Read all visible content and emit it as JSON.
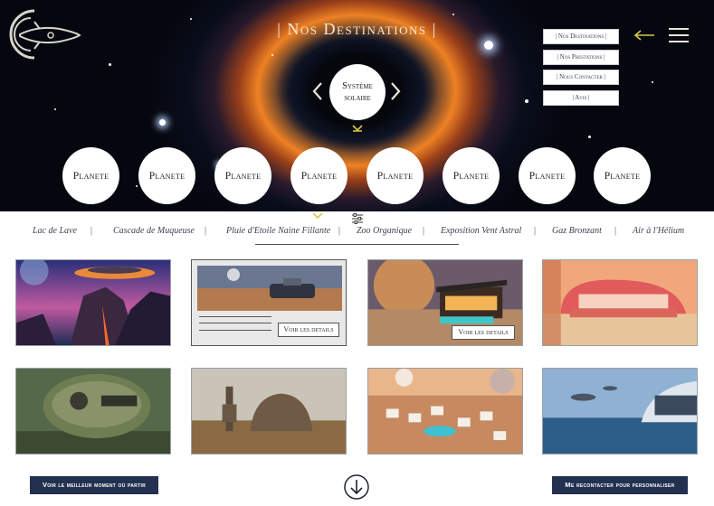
{
  "header": {
    "title": "| Nos Destinations |",
    "nav_items": [
      "| Nos Destinations |",
      "| Nos Prestations |",
      "| Nous Contacter |",
      "| Avis |"
    ]
  },
  "hero": {
    "system_label": "Système solaire",
    "planets": [
      "Planete",
      "Planete",
      "Planete",
      "Planete",
      "Planete",
      "Planete",
      "Planete",
      "Planete"
    ]
  },
  "filters": {
    "items": [
      "Lac de Lave",
      "Cascade de Muqueuse",
      "Pluie d'Etoile Naine Fillante",
      "Zoo Organique",
      "Exposition Vent Astral",
      "Gaz Bronzant",
      "Air à l'Hélium"
    ],
    "active_index": 2
  },
  "cards": {
    "details_label": "Voir les details"
  },
  "footer": {
    "left_button": "Voir le meilleur moment où partir",
    "right_button": "Me recontacter pour personnaliser"
  },
  "colors": {
    "accent_yellow": "#d9c94a",
    "button_navy": "#233150",
    "nebula_orange": "#f08a23"
  }
}
